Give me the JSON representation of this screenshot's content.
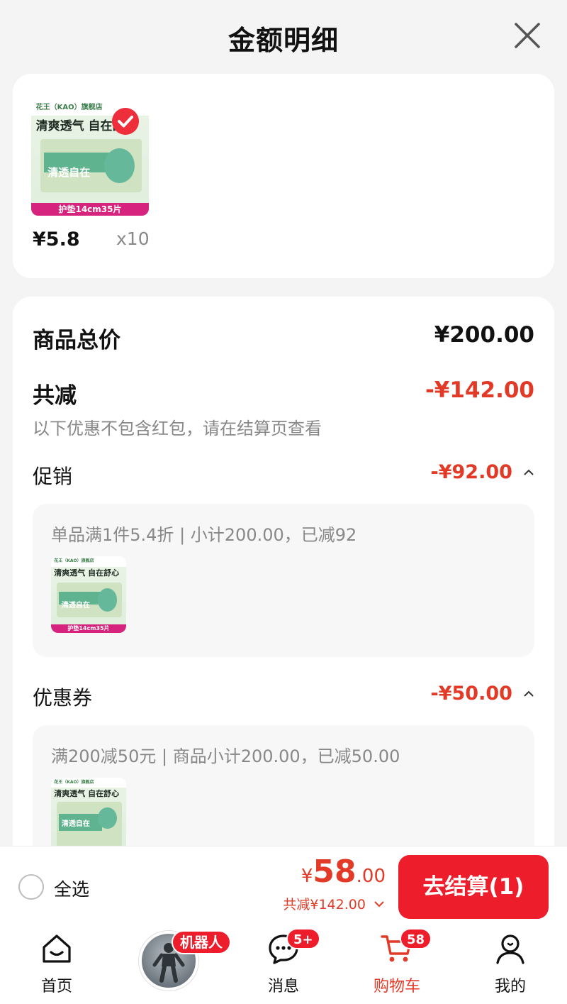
{
  "header": {
    "title": "金额明细"
  },
  "product": {
    "image": {
      "brand": "花王（KAO）旗舰店",
      "slogan": "清爽透气 自在舒心",
      "box_name": "清透自在",
      "label": "护垫14cm35片"
    },
    "price": "¥5.8",
    "qty": "x10"
  },
  "summary": {
    "total_label": "商品总价",
    "total_value": "¥200.00",
    "discount_label": "共减",
    "discount_value": "-¥142.00",
    "note": "以下优惠不包含红包，请在结算页查看"
  },
  "promotion": {
    "label": "促销",
    "value": "-¥92.00",
    "desc": "单品满1件5.4折 | 小计200.00，已减92"
  },
  "coupon": {
    "label": "优惠券",
    "value": "-¥50.00",
    "desc": "满200减50元 | 商品小计200.00，已减50.00"
  },
  "checkout_bar": {
    "select_all": "全选",
    "currency": "¥",
    "total_int": "58",
    "total_dec": ".00",
    "saved": "共减¥142.00",
    "checkout_label": "去结算(1)"
  },
  "tabbar": {
    "home": "首页",
    "robot_badge": "机器人",
    "messages": "消息",
    "messages_badge": "5+",
    "cart": "购物车",
    "cart_badge": "58",
    "me": "我的"
  },
  "colors": {
    "accent_red": "#ee1d2b",
    "price_red": "#e23a26",
    "label_pink": "#d6237d"
  },
  "icons": [
    "close-icon",
    "check-icon",
    "chevron-up-icon",
    "chevron-down-icon",
    "home-icon",
    "chat-icon",
    "cart-icon",
    "user-icon"
  ]
}
